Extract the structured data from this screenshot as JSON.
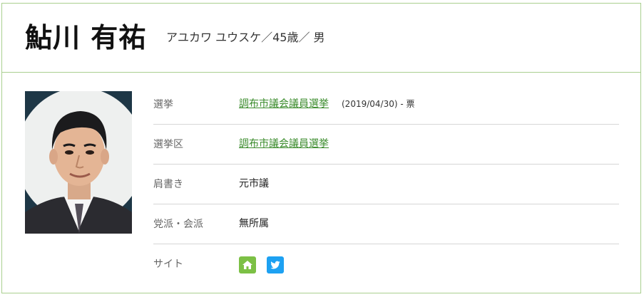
{
  "profile": {
    "name": "鮎川 有祐",
    "kana_age_gender": "アユカワ ユウスケ／45歳／ 男"
  },
  "details": [
    {
      "label": "選挙",
      "value": "調布市議会議員選挙",
      "link": true,
      "meta": "(2019/04/30) - 票"
    },
    {
      "label": "選挙区",
      "value": "調布市議会議員選挙",
      "link": true
    },
    {
      "label": "肩書き",
      "value": "元市議",
      "link": false
    },
    {
      "label": "党派・会派",
      "value": "無所属",
      "link": false
    },
    {
      "label": "サイト"
    }
  ],
  "site_icons": [
    {
      "name": "home-icon",
      "color": "#7cc045"
    },
    {
      "name": "twitter-icon",
      "color": "#1da1f2"
    }
  ]
}
